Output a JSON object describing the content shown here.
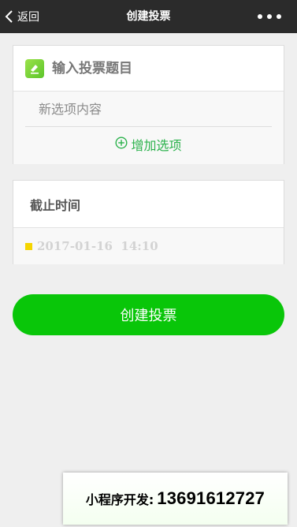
{
  "navbar": {
    "back_label": "返回",
    "title": "创建投票",
    "back_icon": "chevron-left-icon",
    "more_icon": "more-dots-icon"
  },
  "vote": {
    "title_placeholder": "输入投票题目",
    "title_icon": "vote-edit-icon",
    "option_placeholder": "新选项内容",
    "add_option_label": "增加选项",
    "add_option_icon": "plus-circle-icon"
  },
  "deadline": {
    "label": "截止时间",
    "value": "2017-01-16  14:10"
  },
  "actions": {
    "create_label": "创建投票"
  },
  "promo": {
    "label": "小程序开发:",
    "phone": "13691612727"
  },
  "colors": {
    "navbar_bg": "#2b2b2b",
    "accent_green": "#09c609",
    "add_option_green": "#2bb24c",
    "deadline_marker": "#f5d500"
  }
}
